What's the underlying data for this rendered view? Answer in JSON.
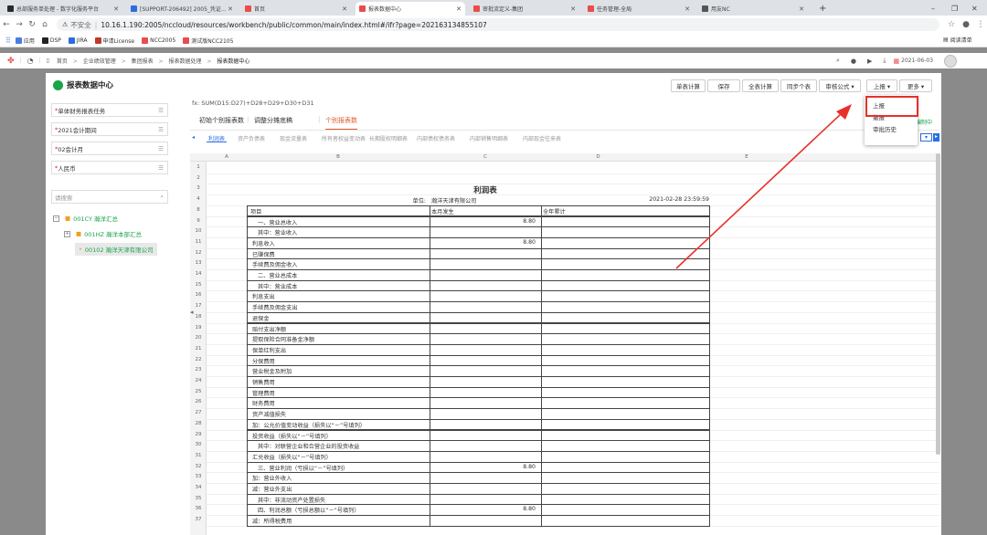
{
  "browser": {
    "tabs": [
      {
        "label": "总部服务单处理 - 数字化服务平台",
        "active": false,
        "color": "#2a2a2a"
      },
      {
        "label": "[SUPPORT-206492] 2005_凭证...",
        "active": false,
        "color": "#2b6de0"
      },
      {
        "label": "首页",
        "active": false,
        "color": "#e94c4c"
      },
      {
        "label": "报表数据中心",
        "active": true,
        "color": "#e94c4c"
      },
      {
        "label": "审批流定义-集团",
        "active": false,
        "color": "#e94c4c"
      },
      {
        "label": "任务管理-全局",
        "active": false,
        "color": "#e94c4c"
      },
      {
        "label": "用友NC",
        "active": false,
        "color": "#555555"
      }
    ],
    "new_tab": "+",
    "security": "不安全",
    "url": "10.16.1.190:2005/nccloud/resources/workbench/public/common/main/index.html#/ifr?page=20216313485510​7",
    "bookmarks": [
      {
        "label": "应用",
        "color": "#4a7de0"
      },
      {
        "label": "DSP",
        "color": "#222222"
      },
      {
        "label": "JIRA",
        "color": "#2b6de0"
      },
      {
        "label": "申请License",
        "color": "#c0392b"
      },
      {
        "label": "NCC2005",
        "color": "#e94c4c"
      },
      {
        "label": "测试版NCC2105",
        "color": "#e94c4c"
      }
    ],
    "reading_list": "阅读清单"
  },
  "app": {
    "breadcrumb": [
      "首页",
      "企业绩效管理",
      "集团报表",
      "报表数据处理",
      "报表数据中心"
    ],
    "date": "2021-06-03"
  },
  "panel": {
    "title": "报表数据中心",
    "buttons": [
      "单表计算",
      "保存",
      "全表计算",
      "同步个表",
      "审核公式 ▾",
      "上报 ▾",
      "更多 ▾"
    ],
    "dropdown": [
      "上报",
      "撤报",
      "审批历史"
    ],
    "formula": "fx: SUM(D15:D27)+D28+D29+D30+D31",
    "filters": [
      "单体财务报表任务",
      "2021会计期间",
      "02会计月",
      "人民币"
    ],
    "search_placeholder": "请搜索",
    "tree": [
      {
        "label": "001CY 瀚洋汇总",
        "level": 0,
        "toggle": "−"
      },
      {
        "label": "001HZ 瀚洋本部汇总",
        "level": 1,
        "toggle": "+"
      },
      {
        "label": "00102 瀚洋天津有限公司",
        "level": 2,
        "toggle": ""
      }
    ],
    "report_tabs": [
      "初始个别报表数",
      "调整分摊底稿",
      "个别报表数"
    ],
    "report_status": "编制中",
    "sheet_tabs": [
      "利润表",
      "资产负债表",
      "现金流量表",
      "所有者权益变动表",
      "长期股权明细表",
      "内部债权债务表",
      "内部销售明细表",
      "内部现金往来表"
    ],
    "col_headers": [
      "A",
      "B",
      "C",
      "D",
      "E"
    ],
    "report_title": "利润表",
    "unit_label": "单位:",
    "company": "瀚洋天津有限公司",
    "timestamp": "2021-02-28 23:59:59",
    "header_row": {
      "item": "项目",
      "d": "本月发生",
      "e": "全年累计"
    },
    "rows": [
      {
        "n": "1",
        "item": "",
        "d": "",
        "e": "",
        "box": false
      },
      {
        "n": "2",
        "item": "",
        "d": "",
        "e": "",
        "box": false
      },
      {
        "n": "3",
        "item": "",
        "d": "",
        "e": "",
        "box": false
      },
      {
        "n": "4",
        "item": "",
        "d": "",
        "e": "",
        "box": false
      },
      {
        "n": "8",
        "item": "",
        "d": "",
        "e": "",
        "box": true
      },
      {
        "n": "9",
        "item": "一、营业总收入",
        "d": "8.80",
        "e": "",
        "box": true
      },
      {
        "n": "10",
        "item": "其中：营业收入",
        "d": "",
        "e": "",
        "box": true
      },
      {
        "n": "11",
        "item": "利息收入",
        "d": "8.80",
        "e": "",
        "box": true
      },
      {
        "n": "12",
        "item": "已赚保费",
        "d": "",
        "e": "",
        "box": true
      },
      {
        "n": "13",
        "item": "手续费及佣金收入",
        "d": "",
        "e": "",
        "box": true
      },
      {
        "n": "14",
        "item": "二、营业总成本",
        "d": "",
        "e": "",
        "box": true
      },
      {
        "n": "15",
        "item": "其中：营业成本",
        "d": "",
        "e": "",
        "box": true
      },
      {
        "n": "16",
        "item": "利息支出",
        "d": "",
        "e": "",
        "box": true
      },
      {
        "n": "17",
        "item": "手续费及佣金支出",
        "d": "",
        "e": "",
        "box": true
      },
      {
        "n": "18",
        "item": "退保金",
        "d": "",
        "e": "",
        "box": true
      },
      {
        "n": "19",
        "item": "赔付支出净额",
        "d": "",
        "e": "",
        "box": true
      },
      {
        "n": "20",
        "item": "提取保险合同准备金净额",
        "d": "",
        "e": "",
        "box": true
      },
      {
        "n": "21",
        "item": "保单红利支出",
        "d": "",
        "e": "",
        "box": true
      },
      {
        "n": "22",
        "item": "分保费用",
        "d": "",
        "e": "",
        "box": true
      },
      {
        "n": "23",
        "item": "营业税金及附加",
        "d": "",
        "e": "",
        "box": true
      },
      {
        "n": "24",
        "item": "销售费用",
        "d": "",
        "e": "",
        "box": true
      },
      {
        "n": "25",
        "item": "管理费用",
        "d": "",
        "e": "",
        "box": true
      },
      {
        "n": "26",
        "item": "财务费用",
        "d": "",
        "e": "",
        "box": true
      },
      {
        "n": "27",
        "item": "资产减值损失",
        "d": "",
        "e": "",
        "box": true
      },
      {
        "n": "28",
        "item": "加：公允价值变动收益（损失以“－”号填列）",
        "d": "",
        "e": "",
        "box": true
      },
      {
        "n": "29",
        "item": "投资收益（损失以“－”号填列）",
        "d": "",
        "e": "",
        "box": true
      },
      {
        "n": "30",
        "item": "其中：对联营企业和合营企业的投资收益",
        "d": "",
        "e": "",
        "box": true
      },
      {
        "n": "31",
        "item": "汇兑收益（损失以“－”号填列）",
        "d": "",
        "e": "",
        "box": true
      },
      {
        "n": "32",
        "item": "三、营业利润（亏损以“－”号填列）",
        "d": "8.80",
        "e": "",
        "box": true
      },
      {
        "n": "33",
        "item": "加：营业外收入",
        "d": "",
        "e": "",
        "box": true
      },
      {
        "n": "34",
        "item": "减：营业外支出",
        "d": "",
        "e": "",
        "box": true
      },
      {
        "n": "35",
        "item": "其中：非流动资产处置损失",
        "d": "",
        "e": "",
        "box": true
      },
      {
        "n": "36",
        "item": "四、利润总额（亏损总额以“－”号填列）",
        "d": "8.80",
        "e": "",
        "box": true
      },
      {
        "n": "37",
        "item": "减：所得税费用",
        "d": "",
        "e": "",
        "box": true
      }
    ]
  },
  "colors": {
    "accent": "#e05a2b",
    "green": "#1aa34a",
    "red_annotation": "#e8302a"
  }
}
